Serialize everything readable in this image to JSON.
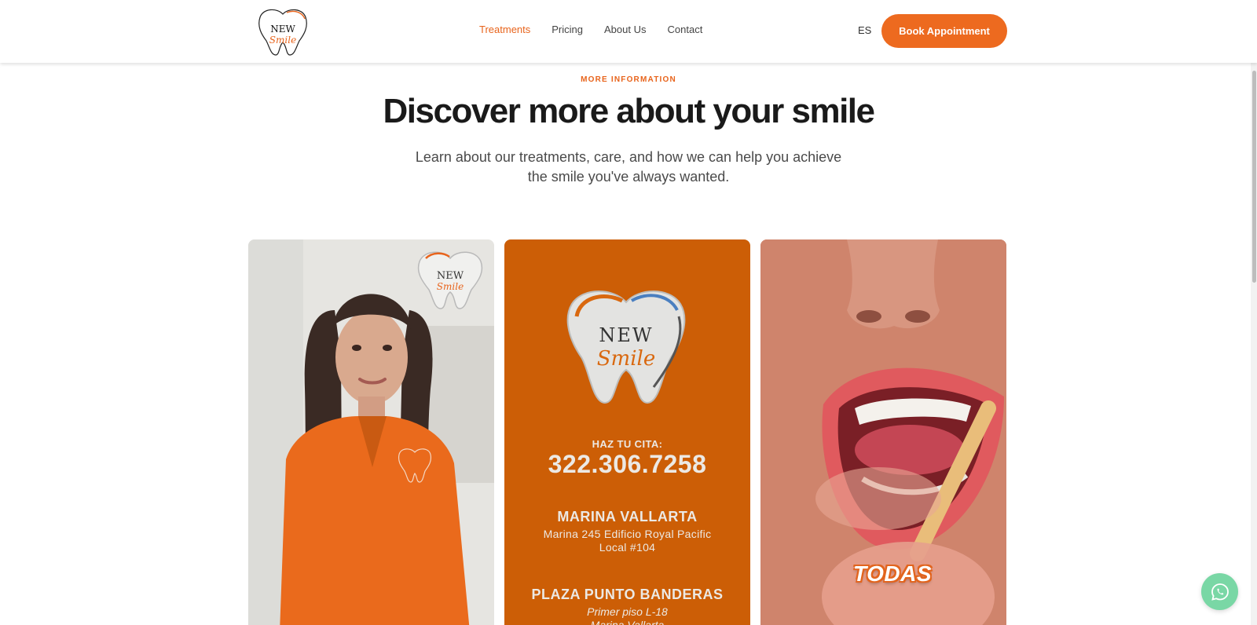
{
  "brand": {
    "logo_word1": "NEW",
    "logo_word2": "Smile",
    "accent": "#ed6a1f",
    "icon": "tooth-logo-icon"
  },
  "nav": {
    "items": [
      {
        "label": "Treatments",
        "active": true
      },
      {
        "label": "Pricing",
        "active": false
      },
      {
        "label": "About Us",
        "active": false
      },
      {
        "label": "Contact",
        "active": false
      }
    ],
    "lang": "ES",
    "book_label": "Book Appointment"
  },
  "intro": {
    "eyebrow": "MORE INFORMATION",
    "title": "Discover more about your smile",
    "lead_line1": "Learn about our treatments, care, and how we can help you achieve",
    "lead_line2": "the smile you've always wanted."
  },
  "cards": {
    "contact": {
      "bg": "#cc5e06",
      "cta_label": "HAZ TU CITA:",
      "phone": "322.306.7258",
      "location1_name": "MARINA VALLARTA",
      "location1_addr1": "Marina 245 Edificio Royal Pacific",
      "location1_addr2": "Local #104",
      "location2_name": "PLAZA PUNTO BANDERAS",
      "location2_addr1": "Primer piso L-18",
      "location2_addr2": "Marina Vallarta"
    },
    "brushing": {
      "overlay_text": "TODAS"
    }
  },
  "whatsapp": {
    "icon": "whatsapp-icon",
    "color": "#79d7a5"
  }
}
